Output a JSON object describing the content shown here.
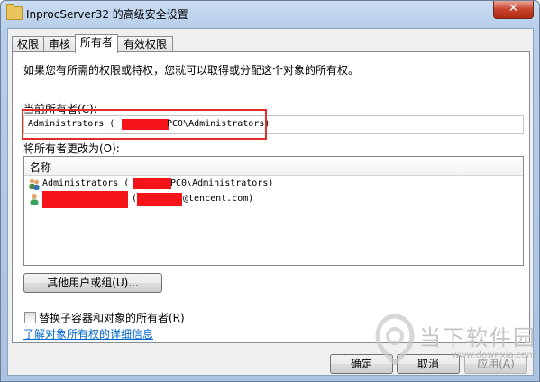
{
  "window": {
    "title": "InprocServer32 的高级安全设置",
    "close_glyph": "✕"
  },
  "tabs": [
    {
      "label": "权限",
      "active": false
    },
    {
      "label": "审核",
      "active": false
    },
    {
      "label": "所有者",
      "active": true
    },
    {
      "label": "有效权限",
      "active": false
    }
  ],
  "owner_tab": {
    "intro": "如果您有所需的权限或特权，您就可以取得或分配这个对象的所有权。",
    "current_owner_label": "当前所有者(C):",
    "current_owner_value_prefix": "Administrators (",
    "current_owner_value_suffix": "PC0\\Administrators)",
    "change_owner_label": "将所有者更改为(O):",
    "list_header_name": "名称",
    "owners_list": [
      {
        "prefix": "Administrators (",
        "suffix": "PC0\\Administrators)",
        "icon": "group-users-icon"
      },
      {
        "prefix": "(",
        "suffix": "@tencent.com)",
        "icon": "user-icon"
      }
    ],
    "other_users_button": "其他用户或组(U)...",
    "replace_checkbox_label": "替换子容器和对象的所有者(R)",
    "replace_checked": false,
    "learn_more_link": "了解对象所有权的详细信息"
  },
  "footer": {
    "ok_button": "确定",
    "cancel_button": "取消",
    "apply_button": "应用(A)"
  },
  "watermark": {
    "brand": "当下软件园",
    "url": "www.downxia.com"
  },
  "colors": {
    "highlight_red": "#e0302a",
    "redaction_red": "#f4141a",
    "link_blue": "#0066cc"
  }
}
